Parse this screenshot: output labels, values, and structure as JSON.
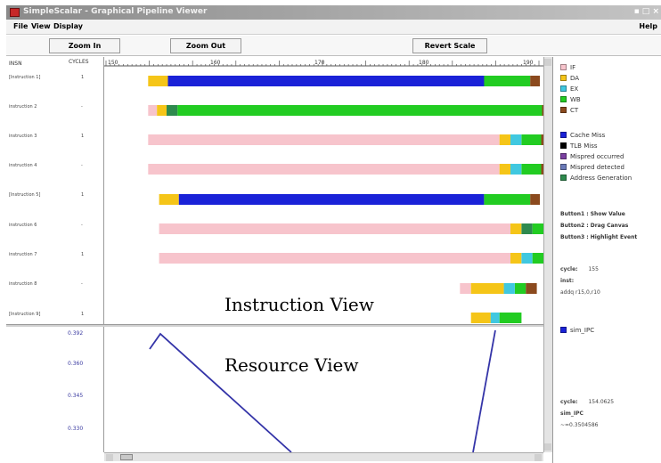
{
  "window": {
    "title": "SimpleScalar - Graphical Pipeline Viewer",
    "controls": "▪ □ ×"
  },
  "menu": {
    "items": [
      "File",
      "View",
      "Display"
    ],
    "help": "Help"
  },
  "toolbar": {
    "zoom_in": "Zoom In",
    "zoom_out": "Zoom Out",
    "revert_scale": "Revert Scale"
  },
  "axis": {
    "left_label": "INSN",
    "cycles_label": "CYCLES",
    "ticks": [
      "150",
      "160",
      "170",
      "180",
      "190"
    ]
  },
  "instructions": [
    {
      "label": "[Instruction 1]",
      "tick": "1"
    },
    {
      "label": "instruction 2",
      "tick": "-"
    },
    {
      "label": "instruction 3",
      "tick": "1"
    },
    {
      "label": "instruction 4",
      "tick": "-"
    },
    {
      "label": "[Instruction 5]",
      "tick": "1"
    },
    {
      "label": "instruction 6",
      "tick": "-"
    },
    {
      "label": "instruction 7",
      "tick": "1"
    },
    {
      "label": "instruction 8",
      "tick": "-"
    },
    {
      "label": "[Instruction 9]",
      "tick": "1"
    }
  ],
  "resource_view": {
    "yticks": [
      "0.392",
      "0.360",
      "0.345",
      "0.330"
    ]
  },
  "legend": {
    "stages": [
      {
        "name": "IF",
        "color": "#f7c4cc"
      },
      {
        "name": "DA",
        "color": "#f5c518"
      },
      {
        "name": "EX",
        "color": "#40c8e0"
      },
      {
        "name": "WB",
        "color": "#22cc22"
      },
      {
        "name": "CT",
        "color": "#8b4a1e"
      }
    ],
    "events": [
      {
        "name": "Cache Miss",
        "color": "#1a22d8"
      },
      {
        "name": "TLB Miss",
        "color": "#000000"
      },
      {
        "name": "Mispred occurred",
        "color": "#7a3fa0"
      },
      {
        "name": "Mispred detected",
        "color": "#6a7ab8"
      },
      {
        "name": "Address Generation",
        "color": "#2e8a4e"
      }
    ],
    "mouse_help": [
      "Button1 : Show Value",
      "Button2 : Drag Canvas",
      "Button3 : Highlight Event"
    ],
    "cycle_info": {
      "cycle_label": "cycle:",
      "cycle_value": "155",
      "inst_label": "inst:",
      "inst_value": "addq r15,0,r10"
    },
    "series": {
      "name": "sim_IPC",
      "color": "#1a22d8"
    },
    "resource_info": {
      "cycle_label": "cycle:",
      "cycle_value": "154.0625",
      "name": "sim_IPC",
      "value": "~=0.3504586"
    }
  },
  "overlay": {
    "instruction_view": "Instruction View",
    "resource_view": "Resource View"
  },
  "pipeline_rows": [
    [
      {
        "s": "DA",
        "len": 0.045
      },
      {
        "s": "CM",
        "len": 0.72
      },
      {
        "s": "WB",
        "len": 0.105
      },
      {
        "s": "CT",
        "len": 0.022
      }
    ],
    [
      {
        "s": "IF",
        "len": 0.02
      },
      {
        "s": "DA",
        "len": 0.022
      },
      {
        "s": "AG",
        "len": 0.025
      },
      {
        "s": "WB",
        "len": 0.83
      },
      {
        "s": "CT",
        "len": 0.025
      }
    ],
    [
      {
        "s": "IF",
        "len": 0.8
      },
      {
        "s": "DA",
        "len": 0.025
      },
      {
        "s": "EX",
        "len": 0.025
      },
      {
        "s": "WB",
        "len": 0.045
      },
      {
        "s": "CT",
        "len": 0.025
      }
    ],
    [
      {
        "s": "IF",
        "len": 0.8
      },
      {
        "s": "DA",
        "len": 0.025
      },
      {
        "s": "EX",
        "len": 0.025
      },
      {
        "s": "WB",
        "len": 0.045
      },
      {
        "s": "CT",
        "len": 0.025
      }
    ],
    [
      {
        "s": "DA",
        "len": 0.045
      },
      {
        "s": "CM",
        "len": 0.695
      },
      {
        "s": "WB",
        "len": 0.105
      },
      {
        "s": "CT",
        "len": 0.022
      }
    ],
    [
      {
        "s": "IF",
        "len": 0.8
      },
      {
        "s": "DA",
        "len": 0.025
      },
      {
        "s": "AG",
        "len": 0.025
      },
      {
        "s": "WB",
        "len": 0.045
      },
      {
        "s": "CT",
        "len": 0.025
      }
    ],
    [
      {
        "s": "IF",
        "len": 0.8
      },
      {
        "s": "DA",
        "len": 0.025
      },
      {
        "s": "EX",
        "len": 0.025
      },
      {
        "s": "WB",
        "len": 0.045
      },
      {
        "s": "CT",
        "len": 0.025
      }
    ],
    [
      {
        "s": "IF",
        "len": 0.025
      },
      {
        "s": "DA",
        "len": 0.075
      },
      {
        "s": "EX",
        "len": 0.025
      },
      {
        "s": "WB",
        "len": 0.025
      },
      {
        "s": "CT",
        "len": 0.025
      }
    ],
    [
      {
        "s": "DA",
        "len": 0.045
      },
      {
        "s": "EX",
        "len": 0.02
      },
      {
        "s": "WB",
        "len": 0.05
      }
    ]
  ],
  "stage_colors": {
    "IF": "#f7c4cc",
    "DA": "#f5c518",
    "EX": "#40c8e0",
    "WB": "#22cc22",
    "CT": "#8b4a1e",
    "CM": "#1a22d8",
    "AG": "#2e8a4e"
  }
}
